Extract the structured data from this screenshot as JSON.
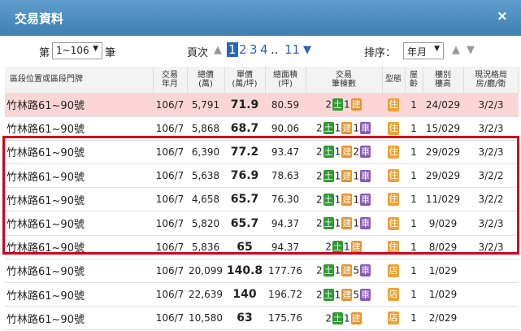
{
  "window": {
    "title": "交易資料",
    "close_glyph": "×"
  },
  "toolbar": {
    "range_prefix": "第",
    "range_value": "1~106",
    "range_suffix": "筆",
    "page_label": "頁次",
    "pages": [
      "1",
      "2",
      "3",
      "4"
    ],
    "ellipsis": "..",
    "last_page": "11",
    "sort_label": "排序：",
    "sort_value": "年月"
  },
  "columns": {
    "loc": "區段位置或區段門牌",
    "ym": [
      "交易",
      "年月"
    ],
    "total": [
      "總價",
      "(萬)"
    ],
    "unit": [
      "單價",
      "(萬/坪)"
    ],
    "area": [
      "總面積",
      "(坪)"
    ],
    "count": [
      "交易",
      "筆棟數"
    ],
    "type": "型態",
    "age": [
      "屋",
      "齡"
    ],
    "floor": [
      "樓別",
      "樓高"
    ],
    "layout": [
      "現況格局",
      "房/廳/衛"
    ]
  },
  "rows": [
    {
      "loc": "竹林路61~90號",
      "ym": "106/7",
      "total": "5,791",
      "unit": "71.9",
      "area": "80.59",
      "n1": "2",
      "n2": "1",
      "n3": "",
      "type": "住",
      "age": "1",
      "floor": "24/029",
      "layout": "3/2/3",
      "highlight": true
    },
    {
      "loc": "竹林路61~90號",
      "ym": "106/7",
      "total": "5,868",
      "unit": "68.7",
      "area": "90.06",
      "n1": "2",
      "n2": "1",
      "n3": "1",
      "type": "住",
      "age": "1",
      "floor": "15/029",
      "layout": "3/2/3",
      "highlight": false
    },
    {
      "loc": "竹林路61~90號",
      "ym": "106/7",
      "total": "6,390",
      "unit": "77.2",
      "area": "93.47",
      "n1": "2",
      "n2": "1",
      "n3": "2",
      "type": "住",
      "age": "1",
      "floor": "29/029",
      "layout": "3/2/3",
      "highlight": false
    },
    {
      "loc": "竹林路61~90號",
      "ym": "106/7",
      "total": "5,638",
      "unit": "76.9",
      "area": "78.63",
      "n1": "2",
      "n2": "1",
      "n3": "1",
      "type": "住",
      "age": "1",
      "floor": "29/029",
      "layout": "3/2/2",
      "highlight": false
    },
    {
      "loc": "竹林路61~90號",
      "ym": "106/7",
      "total": "4,658",
      "unit": "65.7",
      "area": "76.30",
      "n1": "2",
      "n2": "1",
      "n3": "1",
      "type": "住",
      "age": "1",
      "floor": "11/029",
      "layout": "3/2/2",
      "highlight": false
    },
    {
      "loc": "竹林路61~90號",
      "ym": "106/7",
      "total": "5,820",
      "unit": "65.7",
      "area": "94.37",
      "n1": "2",
      "n2": "1",
      "n3": "1",
      "type": "住",
      "age": "1",
      "floor": "9/029",
      "layout": "3/2/3",
      "highlight": false
    },
    {
      "loc": "竹林路61~90號",
      "ym": "106/7",
      "total": "5,836",
      "unit": "65",
      "area": "94.37",
      "n1": "2",
      "n2": "1",
      "n3": "",
      "type": "住",
      "age": "1",
      "floor": "8/029",
      "layout": "3/2/3",
      "highlight": false
    },
    {
      "loc": "竹林路61~90號",
      "ym": "106/7",
      "total": "20,099",
      "unit": "140.8",
      "area": "177.76",
      "n1": "2",
      "n2": "1",
      "n3": "5",
      "type": "店",
      "age": "1",
      "floor": "1/029",
      "layout": "",
      "highlight": false
    },
    {
      "loc": "竹林路61~90號",
      "ym": "106/7",
      "total": "22,639",
      "unit": "140",
      "area": "196.72",
      "n1": "2",
      "n2": "1",
      "n3": "5",
      "type": "店",
      "age": "1",
      "floor": "1/029",
      "layout": "",
      "highlight": false
    },
    {
      "loc": "竹林路61~90號",
      "ym": "106/7",
      "total": "10,580",
      "unit": "63",
      "area": "175.76",
      "n1": "2",
      "n2": "1",
      "n3": "",
      "type": "店",
      "age": "1",
      "floor": "2/029",
      "layout": "",
      "highlight": false
    }
  ],
  "badges": {
    "land": "土",
    "building": "建",
    "parking": "車"
  },
  "colors": {
    "title_bar": "#4a8cc0",
    "highlight_row": "#fcd6d6",
    "annotation_box": "#d0021b",
    "land_badge": "#2f9a33",
    "building_badge": "#e3942c",
    "parking_badge": "#8a5ab5",
    "type_badge": "#f0a230"
  },
  "icons": [
    "close-icon",
    "prev-page-arrow-icon",
    "next-page-arrow-icon",
    "dropdown-arrow-icon",
    "sort-asc-icon",
    "sort-desc-icon"
  ]
}
